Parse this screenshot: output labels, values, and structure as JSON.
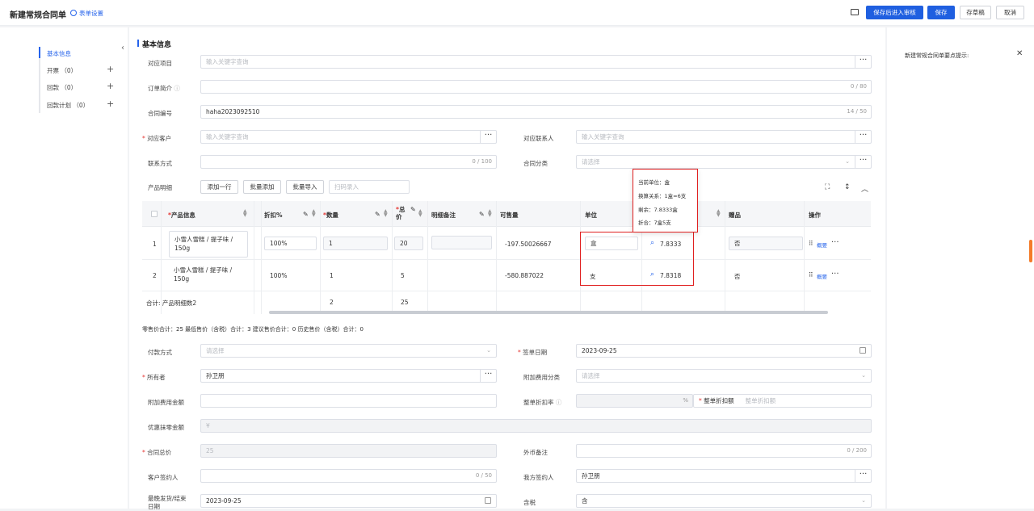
{
  "header": {
    "title": "新建常规合同单",
    "form_settings": "表单设置",
    "btn_save_submit": "保存后进入审核",
    "btn_save": "保存",
    "btn_draft": "存草稿",
    "btn_cancel": "取消"
  },
  "nav": {
    "items": [
      {
        "label": "基本信息"
      },
      {
        "label": "开票 （0）"
      },
      {
        "label": "回款 （0）"
      },
      {
        "label": "回款计划 （0）"
      }
    ]
  },
  "right_panel": {
    "title": "新建常规合同单要点提示:"
  },
  "section": {
    "title": "基本信息"
  },
  "fields": {
    "project_label": "对应项目",
    "project_ph": "输入关键字查询",
    "brief_label": "订单简介",
    "brief_count": "0 / 80",
    "contract_no_label": "合同编号",
    "contract_no_value": "haha2023092510",
    "contract_no_count": "14 / 50",
    "customer_label": "对应客户",
    "customer_ph": "输入关键字查询",
    "contact_label": "对应联系人",
    "contact_ph": "输入关键字查询",
    "phone_label": "联系方式",
    "phone_count": "0 / 100",
    "category_label": "合同分类",
    "category_ph": "请选择",
    "products_label": "产品明细",
    "add_row": "添加一行",
    "batch_add": "批量添加",
    "batch_import": "批量导入",
    "scan_ph": "扫码录入"
  },
  "table": {
    "headers": [
      "产品信息",
      "折扣%",
      "数量",
      "总价",
      "明细备注",
      "可售量",
      "单位",
      "",
      "赠品",
      "操作"
    ],
    "rows": [
      {
        "no": "1",
        "product": "小雪人雪糕 / 提子味 / 150g",
        "discount": "100%",
        "qty": "1",
        "total": "20",
        "available": "-197.50026667",
        "unit": "盒",
        "stock": "7.8333",
        "gift": "否",
        "op": "概要"
      },
      {
        "no": "2",
        "product": "小雪人雪糕 / 提子味 / 150g",
        "discount": "100%",
        "qty": "1",
        "total": "5",
        "available": "-580.887022",
        "unit": "支",
        "stock": "7.8318",
        "gift": "否",
        "op": "概要"
      }
    ],
    "footer_label": "合计:  产品明细数2",
    "footer_qty": "2",
    "footer_total": "25"
  },
  "tooltip": {
    "line1": "当前单位：盒",
    "line2": "换算关系：1盒=6支",
    "line3": "剩余：7.8333盒",
    "line4": "折合：7盒5支"
  },
  "summary": "零售价合计：25  最低售价（含税）合计：3  建议售价合计：0  历史售价（含税）合计：0",
  "fields2": {
    "pay_label": "付款方式",
    "pay_ph": "请选择",
    "sign_date_label": "签单日期",
    "sign_date": "2023-09-25",
    "owner_label": "所有者",
    "owner": "孙卫朋",
    "fee_type_label": "附加费用分类",
    "fee_type_ph": "请选择",
    "fee_amt_label": "附加费用金额",
    "discount_rate_label": "整单折扣率",
    "discount_amt_label": "整单折扣额",
    "discount_amt_ph": "整单折扣额",
    "percent": "%",
    "wipe_label": "优惠抹零金额",
    "wipe_ph": "¥",
    "total_label": "合同总价",
    "total_value": "25",
    "fx_label": "外币备注",
    "fx_count": "0 / 200",
    "cust_signer_label": "客户签约人",
    "cust_signer_count": "0 / 50",
    "our_signer_label": "我方签约人",
    "our_signer": "孙卫朋",
    "ship_label": "最晚发货/结束日期",
    "ship_date": "2023-09-25",
    "tax_label": "含税",
    "tax_value": "含"
  }
}
